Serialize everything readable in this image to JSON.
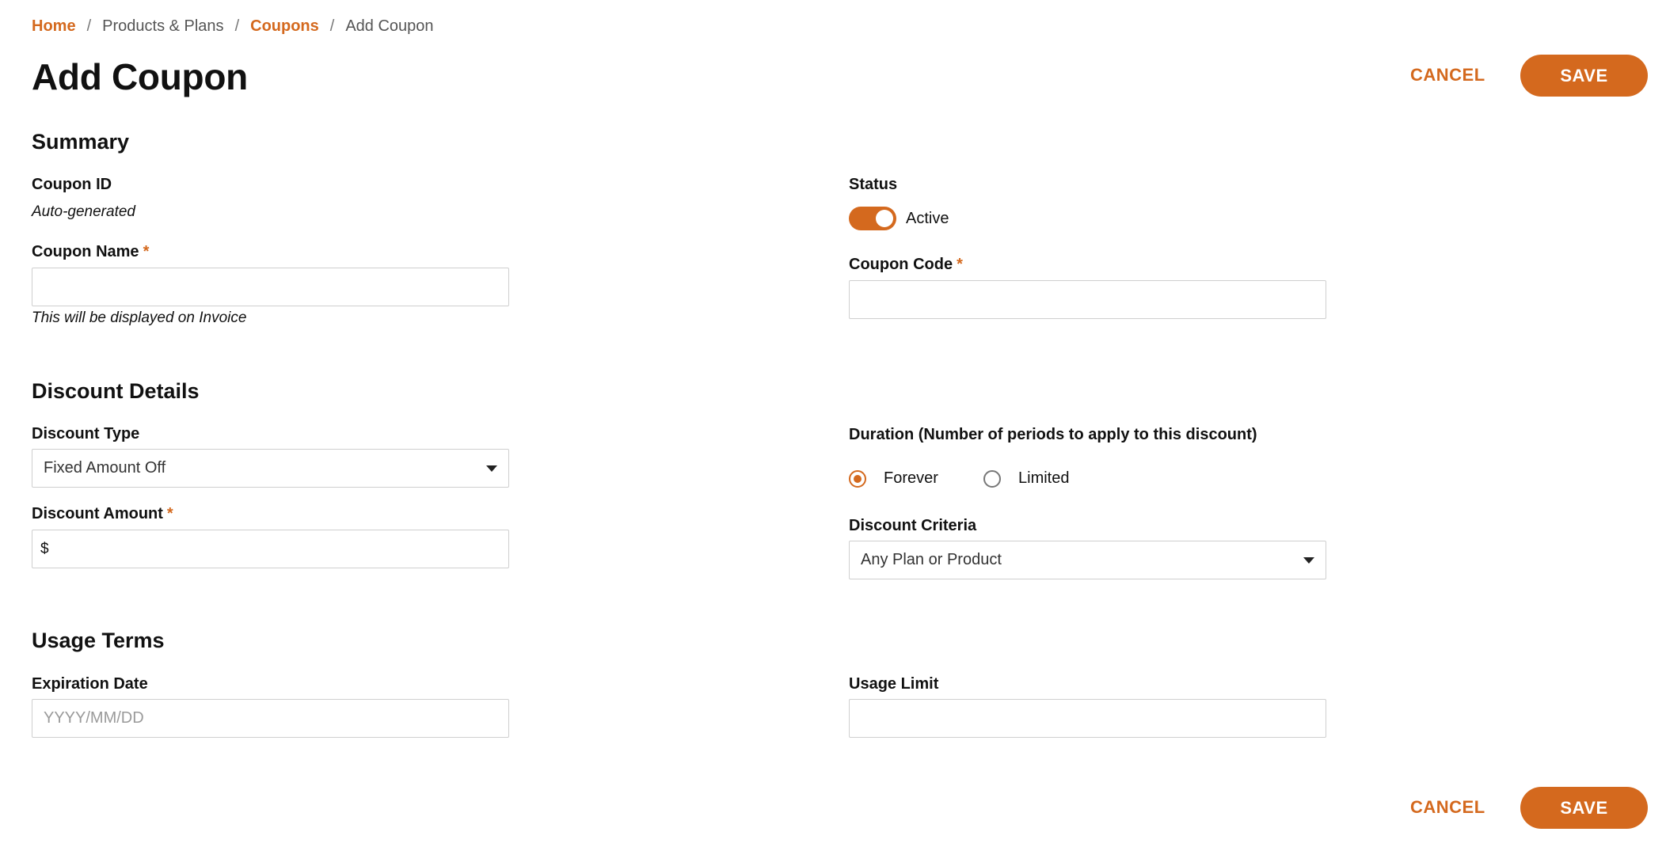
{
  "breadcrumb": {
    "home": "Home",
    "products": "Products & Plans",
    "coupons": "Coupons",
    "current": "Add Coupon",
    "separator": "/"
  },
  "page": {
    "title": "Add Coupon",
    "cancel_label": "CANCEL",
    "save_label": "SAVE"
  },
  "summary": {
    "title": "Summary",
    "coupon_id_label": "Coupon ID",
    "coupon_id_value": "Auto-generated",
    "coupon_name_label": "Coupon Name",
    "coupon_name_value": "",
    "coupon_name_hint": "This will be displayed on Invoice",
    "status_label": "Status",
    "status_value": "Active",
    "status_on": true,
    "coupon_code_label": "Coupon Code",
    "coupon_code_value": ""
  },
  "discount": {
    "title": "Discount Details",
    "type_label": "Discount Type",
    "type_value": "Fixed Amount Off",
    "amount_label": "Discount Amount",
    "amount_prefix": "$",
    "amount_value": "",
    "duration_label": "Duration (Number of periods to apply to this discount)",
    "duration_options": [
      "Forever",
      "Limited"
    ],
    "duration_selected": "Forever",
    "criteria_label": "Discount Criteria",
    "criteria_value": "Any Plan or Product"
  },
  "usage": {
    "title": "Usage Terms",
    "expiration_label": "Expiration Date",
    "expiration_placeholder": "YYYY/MM/DD",
    "expiration_value": "",
    "limit_label": "Usage Limit",
    "limit_value": ""
  },
  "required_marker": "*",
  "colors": {
    "accent": "#d4691e",
    "border": "#cfcfcf",
    "text": "#111111"
  }
}
